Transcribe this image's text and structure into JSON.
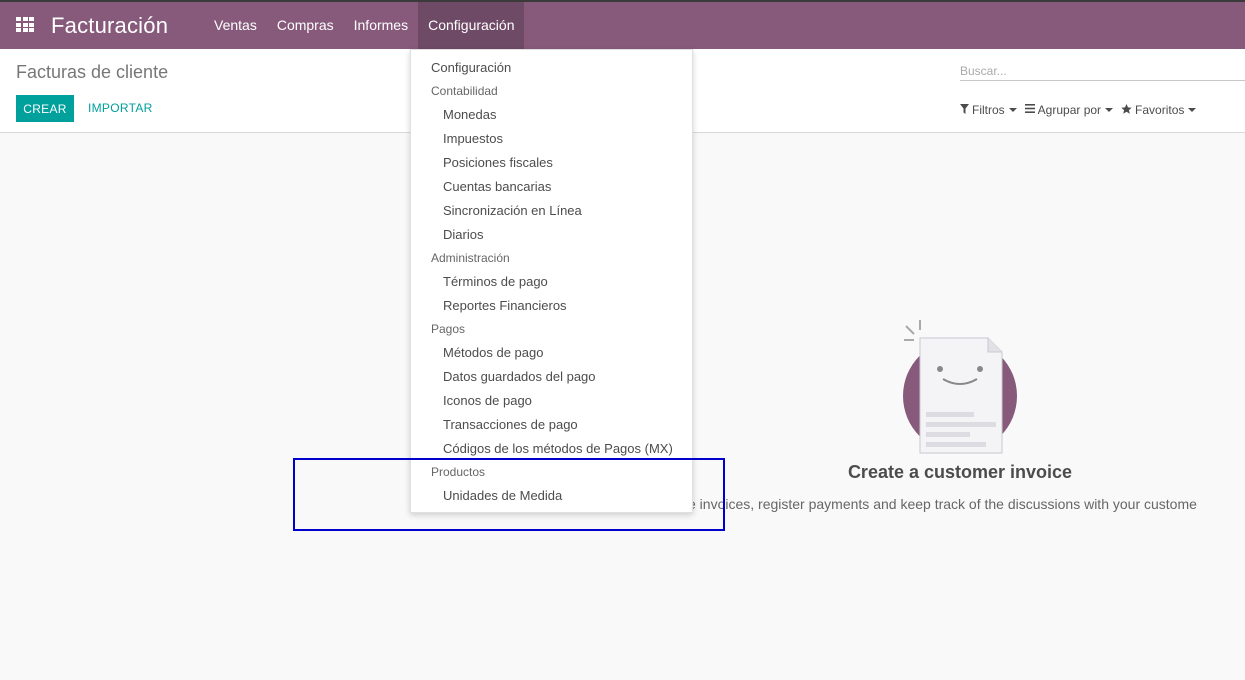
{
  "topbar": {
    "app_title": "Facturación",
    "nav": [
      "Ventas",
      "Compras",
      "Informes",
      "Configuración"
    ],
    "active_index": 3,
    "apps_icon": "grid-apps-icon",
    "bg_color": "#875a7b"
  },
  "control_panel": {
    "title": "Facturas de cliente",
    "create_label": "CREAR",
    "import_label": "IMPORTAR",
    "search_placeholder": "Buscar...",
    "filters_label": "Filtros",
    "groupby_label": "Agrupar por",
    "favorites_label": "Favoritos"
  },
  "help": {
    "title": "Create a customer invoice",
    "text": "e invoices, register payments and keep track of the discussions with your custome"
  },
  "dropdown": {
    "config_label": "Configuración",
    "sections": [
      {
        "header": "Contabilidad",
        "items": [
          "Monedas",
          "Impuestos",
          "Posiciones fiscales",
          "Cuentas bancarias",
          "Sincronización en Línea",
          "Diarios"
        ]
      },
      {
        "header": "Administración",
        "items": [
          "Términos de pago",
          "Reportes Financieros"
        ]
      },
      {
        "header": "Pagos",
        "items": [
          "Métodos de pago",
          "Datos guardados del pago",
          "Iconos de pago",
          "Transacciones de pago",
          "Códigos de los métodos de Pagos (MX)"
        ]
      },
      {
        "header": "Productos",
        "items": [
          "Unidades de Medida"
        ]
      }
    ]
  },
  "colors": {
    "brand": "#875a7b",
    "accent": "#00a09d",
    "highlight": "#0000cc"
  }
}
